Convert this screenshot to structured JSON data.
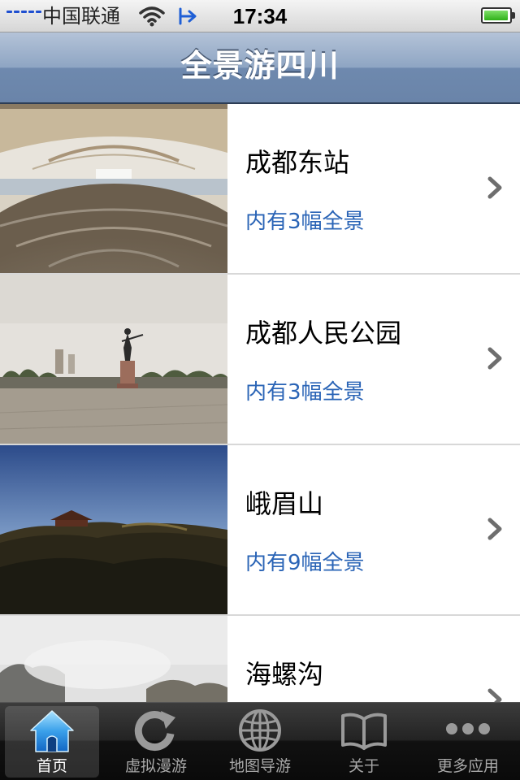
{
  "status_bar": {
    "carrier": "中国联通",
    "time": "17:34",
    "battery_level": 0.95,
    "icons": [
      "signal-icon",
      "wifi-icon",
      "location-arrow-icon",
      "battery-icon"
    ]
  },
  "nav": {
    "title": "全景游四川"
  },
  "list": {
    "items": [
      {
        "title": "成都东站",
        "subtitle": "内有3幅全景"
      },
      {
        "title": "成都人民公园",
        "subtitle": "内有3幅全景"
      },
      {
        "title": "峨眉山",
        "subtitle": "内有9幅全景"
      },
      {
        "title": "海螺沟",
        "subtitle": ""
      }
    ]
  },
  "tabs": [
    {
      "label": "首页",
      "icon": "home-icon",
      "selected": true
    },
    {
      "label": "虚拟漫游",
      "icon": "refresh-icon",
      "selected": false
    },
    {
      "label": "地图导游",
      "icon": "globe-icon",
      "selected": false
    },
    {
      "label": "关于",
      "icon": "book-icon",
      "selected": false
    },
    {
      "label": "更多应用",
      "icon": "more-dots-icon",
      "selected": false
    }
  ],
  "colors": {
    "accent_subtitle": "#2a64b6",
    "nav_bar": "#7e97b8",
    "tab_selected_icon": "#3aa0ea"
  }
}
